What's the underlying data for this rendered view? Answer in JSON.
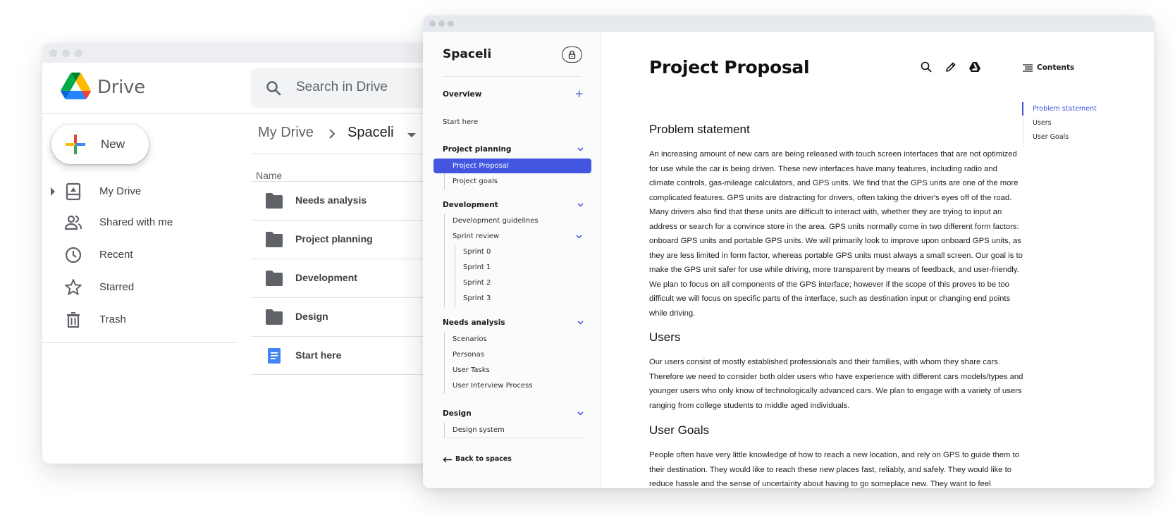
{
  "drive": {
    "title": "Drive",
    "search_placeholder": "Search in Drive",
    "new_label": "New",
    "nav": [
      {
        "label": "My Drive",
        "icon": "my-drive-icon"
      },
      {
        "label": "Shared with me",
        "icon": "shared-icon"
      },
      {
        "label": "Recent",
        "icon": "clock-icon"
      },
      {
        "label": "Starred",
        "icon": "star-icon"
      },
      {
        "label": "Trash",
        "icon": "trash-icon"
      }
    ],
    "breadcrumb": {
      "root": "My Drive",
      "current": "Spaceli"
    },
    "column_name": "Name",
    "files": [
      {
        "name": "Needs analysis",
        "type": "folder"
      },
      {
        "name": "Project planning",
        "type": "folder"
      },
      {
        "name": "Development",
        "type": "folder"
      },
      {
        "name": "Design",
        "type": "folder"
      },
      {
        "name": "Start here",
        "type": "doc"
      }
    ],
    "colors": {
      "folder": "#5f6368",
      "doc": "#4285f4",
      "google_blue": "#4285f4",
      "google_red": "#ea4335",
      "google_yellow": "#fbbc04",
      "google_green": "#34a853"
    }
  },
  "spaceli": {
    "brand": "Spaceli",
    "sidebar": {
      "overview": "Overview",
      "start_here": "Start here",
      "sections": [
        {
          "title": "Project planning",
          "items": [
            "Project Proposal",
            "Project goals"
          ]
        },
        {
          "title": "Development",
          "items": [
            "Development guidelines",
            "Sprint review"
          ],
          "sprint_items": [
            "Sprint 0",
            "Sprint 1",
            "Sprint 2",
            "Sprint 3"
          ]
        },
        {
          "title": "Needs analysis",
          "items": [
            "Scenarios",
            "Personas",
            "User Tasks",
            "User Interview Process"
          ]
        },
        {
          "title": "Design",
          "items": [
            "Design system"
          ]
        }
      ],
      "back_label": "Back to spaces",
      "active_item": "Project Proposal"
    },
    "doc": {
      "title": "Project Proposal",
      "sections": [
        {
          "heading": "Problem statement",
          "body": "An increasing amount of new cars are being released with touch screen interfaces that are not optimized for use while the car is being driven. These new interfaces have many features, including radio and climate controls, gas-mileage calculators, and GPS units. We find that the GPS units are one of the more complicated features. GPS units are distracting for drivers, often taking the driver's eyes off of the road. Many drivers also find that these units are difficult to interact with, whether they are trying to input an address or search for a convince store in the area. GPS units normally come in two different form factors: onboard GPS units and portable GPS units. We will primarily look to improve upon onboard GPS units, as they are less limited in form factor, whereas portable GPS units must always a small screen. Our goal is to make the GPS unit safer for use while driving, more transparent by means of feedback, and user-friendly. We plan to focus on all components of the GPS interface; however if the scope of this proves to be too difficult we will focus on specific parts of the interface, such as destination input or changing end points while driving."
        },
        {
          "heading": "Users",
          "body": "Our users consist of mostly established professionals and their families, with whom they share cars. Therefore we need to consider both older users who have experience with different cars models/types and younger users who only know of technologically advanced cars. We plan to engage with a variety of users ranging from college students to middle aged individuals."
        },
        {
          "heading": "User Goals",
          "body": "People often have very little knowledge of how to reach a new location, and rely on GPS to guide them to their destination. They would like to reach these new places fast, reliably, and safely. They would like to reduce hassle and the sense of uncertainty about having to go someplace new. They want to feel comfortable and in control of their situation even if they happen to get lost along the way."
        }
      ]
    },
    "contents": {
      "title": "Contents",
      "items": [
        "Problem statement",
        "Users",
        "User Goals"
      ],
      "active": "Problem statement"
    },
    "colors": {
      "accent": "#4356e0"
    }
  }
}
